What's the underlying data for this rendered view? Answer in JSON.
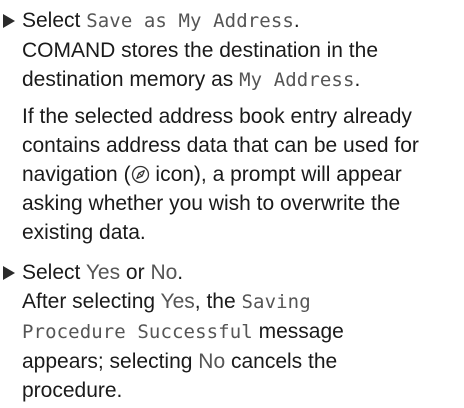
{
  "step1": {
    "pre": "Select ",
    "item": "Save as My Address",
    "post": ".",
    "result_line1": "COMAND stores the destination in the",
    "result_line2_pre": "destination memory as ",
    "result_line2_item": "My Address",
    "result_line2_post": ".",
    "note_line1": "If the selected address book entry already",
    "note_line2": "contains address data that can be used for",
    "note_line3_pre": "navigation (",
    "note_line3_post": " icon), a prompt will appear",
    "note_line4": "asking whether you wish to overwrite the",
    "note_line5": "existing data.",
    "icon": "navigation-compass-icon"
  },
  "step2": {
    "pre": "Select ",
    "yes": "Yes",
    "or": " or ",
    "no": "No",
    "post": ".",
    "r1_pre": "After selecting ",
    "r1_yes": "Yes",
    "r1_mid": ", the ",
    "r1_item": "Saving",
    "r2_item": "Procedure Successful",
    "r2_post": " message",
    "r3_pre": "appears; selecting ",
    "r3_no": "No",
    "r3_post": " cancels the",
    "r4": "procedure."
  },
  "colors": {
    "text": "#1a1a1a",
    "display_text": "#555555",
    "bullet": "#2b2b2b"
  }
}
